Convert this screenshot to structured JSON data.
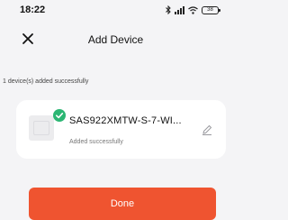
{
  "status_bar": {
    "time": "18:22",
    "battery": "38",
    "icons": [
      "bluetooth-icon",
      "signal-icon",
      "wifi-icon",
      "battery-icon"
    ]
  },
  "header": {
    "title": "Add Device",
    "close_icon": "close-icon"
  },
  "message": "1 device(s) added successfully",
  "device": {
    "name": "SAS922XMTW-S-7-WI...",
    "status": "Added successfully",
    "badge_icon": "check-circle-icon",
    "edit_icon": "pencil-icon"
  },
  "done_button": {
    "label": "Done"
  },
  "colors": {
    "accent": "#ef5430",
    "success": "#2bb673",
    "background": "#f4f4f6",
    "card": "#ffffff"
  }
}
